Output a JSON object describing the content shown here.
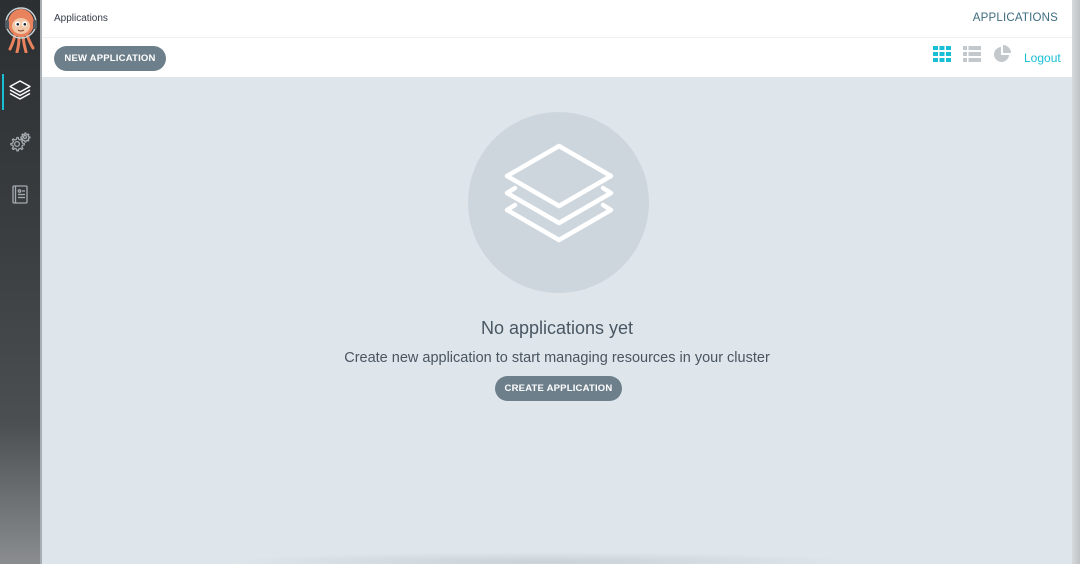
{
  "sidebar": {
    "logo_icon": "argo-octopus-logo",
    "items": [
      {
        "name": "applications",
        "icon": "layers-icon",
        "active": true
      },
      {
        "name": "settings",
        "icon": "gear-icon",
        "active": false
      },
      {
        "name": "user-info",
        "icon": "user-info-icon",
        "active": false
      }
    ]
  },
  "header": {
    "breadcrumb": "Applications",
    "title": "APPLICATIONS"
  },
  "toolbar": {
    "new_application_label": "NEW APPLICATION",
    "views": [
      {
        "name": "tiles",
        "icon": "grid-icon",
        "active": true
      },
      {
        "name": "list",
        "icon": "list-icon",
        "active": false
      },
      {
        "name": "summary",
        "icon": "pie-chart-icon",
        "active": false
      }
    ],
    "logout_label": "Logout"
  },
  "empty_state": {
    "icon": "layers-icon",
    "title": "No applications yet",
    "description": "Create new application to start managing resources in your cluster",
    "button_label": "CREATE APPLICATION"
  },
  "colors": {
    "accent": "#18bed4",
    "button": "#6d7f8b",
    "content_bg": "#dee6eb",
    "sidebar_bg": "#2b2f31"
  }
}
